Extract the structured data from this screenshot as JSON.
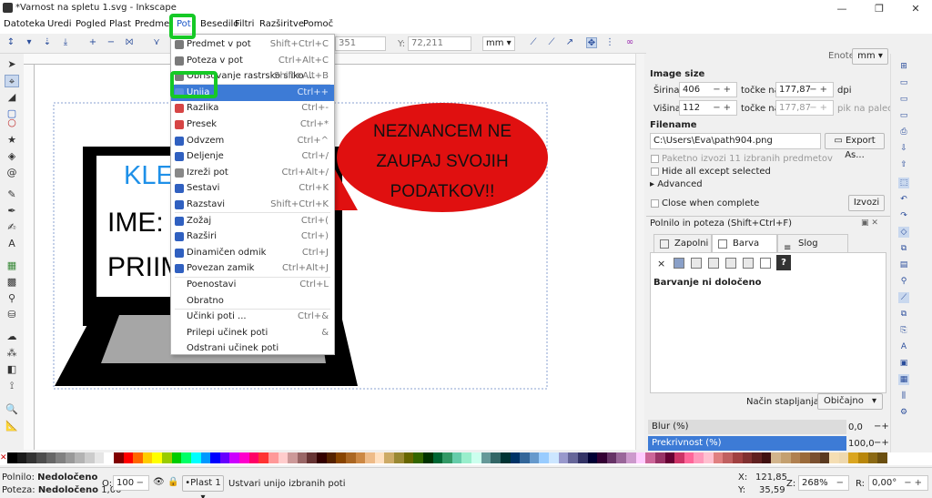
{
  "window": {
    "title": "*Varnost na spletu 1.svg - Inkscape"
  },
  "menubar": {
    "items": [
      "Datoteka",
      "Uredi",
      "Pogled",
      "Plast",
      "Predmet",
      "Pot",
      "Besedilo",
      "Filtri",
      "Razširitve",
      "Pomoč"
    ],
    "active": "Pot"
  },
  "toolctrl": {
    "x_field": "351",
    "y_label": "Y:",
    "y_field": "72,211",
    "unit": "mm"
  },
  "path_menu": {
    "items": [
      {
        "label": "Predmet v pot",
        "shortcut": "Shift+Ctrl+C",
        "icon": "object-to-path-icon",
        "color": "#7a7a7a"
      },
      {
        "label": "Poteza v pot",
        "shortcut": "Ctrl+Alt+C",
        "icon": "stroke-to-path-icon",
        "color": "#7a7a7a"
      },
      {
        "label": "Obrisovanje rastrsko sliko ...",
        "shortcut": "Shift+Alt+B",
        "icon": "trace-bitmap-icon",
        "color": "#7a7a7a"
      },
      {
        "label": "Unija",
        "shortcut": "Ctrl++",
        "icon": "union-icon",
        "color": "#5c8fe0"
      },
      {
        "label": "Razlika",
        "shortcut": "Ctrl+-",
        "icon": "difference-icon",
        "color": "#d64545"
      },
      {
        "label": "Presek",
        "shortcut": "Ctrl+*",
        "icon": "intersection-icon",
        "color": "#d64545"
      },
      {
        "label": "Odvzem",
        "shortcut": "Ctrl+^",
        "icon": "exclusion-icon",
        "color": "#3060c0"
      },
      {
        "label": "Deljenje",
        "shortcut": "Ctrl+/",
        "icon": "division-icon",
        "color": "#3060c0"
      },
      {
        "label": "Izreži pot",
        "shortcut": "Ctrl+Alt+/",
        "icon": "cut-path-icon",
        "color": "#888"
      },
      {
        "label": "Sestavi",
        "shortcut": "Ctrl+K",
        "icon": "combine-icon",
        "color": "#3060c0"
      },
      {
        "label": "Razstavi",
        "shortcut": "Shift+Ctrl+K",
        "icon": "break-apart-icon",
        "color": "#3060c0"
      },
      {
        "label": "Zožaj",
        "shortcut": "Ctrl+(",
        "icon": "inset-icon",
        "color": "#3060c0"
      },
      {
        "label": "Razširi",
        "shortcut": "Ctrl+)",
        "icon": "outset-icon",
        "color": "#3060c0"
      },
      {
        "label": "Dinamičen odmik",
        "shortcut": "Ctrl+J",
        "icon": "dynamic-offset-icon",
        "color": "#3060c0"
      },
      {
        "label": "Povezan zamik",
        "shortcut": "Ctrl+Alt+J",
        "icon": "linked-offset-icon",
        "color": "#3060c0"
      },
      {
        "label": "Poenostavi",
        "shortcut": "Ctrl+L",
        "icon": "",
        "color": ""
      },
      {
        "label": "Obratno",
        "shortcut": "",
        "icon": "",
        "color": ""
      },
      {
        "label": "Učinki poti ...",
        "shortcut": "Ctrl+&",
        "icon": "",
        "color": ""
      },
      {
        "label": "Prilepi učinek poti",
        "shortcut": "&",
        "icon": "",
        "color": ""
      },
      {
        "label": "Odstrani učinek poti",
        "shortcut": "",
        "icon": "",
        "color": ""
      }
    ],
    "selected_index": 3
  },
  "canvas": {
    "monitor_text": [
      "KLE",
      "IME:",
      "PRIIM"
    ],
    "speech_bubble": [
      "NEZNANCEM NE",
      "ZAUPAJ SVOJIH",
      "PODATKOV!!"
    ]
  },
  "export_panel": {
    "units_label": "Enote:",
    "units_value": "mm",
    "image_size_title": "Image size",
    "width_label": "Širina:",
    "width_value": "406",
    "height_label": "Višina:",
    "height_value": "112",
    "dots_at_label": "točke na",
    "dpi_value": "177,87",
    "dpi_unit": "dpi",
    "dpi2_value": "177,87",
    "dpi2_unit": "pik na palec",
    "filename_title": "Filename",
    "filename_value": "C:\\Users\\Eva\\path904.png",
    "export_as_label": "Export As...",
    "batch_label": "Paketno izvozi 11 izbranih predmetov",
    "hide_label": "Hide all except selected",
    "advanced_label": "Advanced",
    "close_label": "Close when complete",
    "export_label": "Izvozi"
  },
  "fill_panel": {
    "title": "Polnilo in poteza  (Shift+Ctrl+F)",
    "tabs": [
      "Zapolni",
      "Barva poteze",
      "Slog poteze"
    ],
    "active_tab": 1,
    "no_paint": "×",
    "message": "Barvanje ni določeno",
    "blend_label": "Način stapljanja:",
    "blend_value": "Običajno",
    "blur_label": "Blur (%)",
    "blur_value": "0,0",
    "opacity_label": "Prekrivnost (%)",
    "opacity_value": "100,0"
  },
  "status": {
    "fill_label": "Polnilo:",
    "fill_value": "Nedoločeno",
    "stroke_label": "Poteza:",
    "stroke_value": "Nedoločeno",
    "stroke_width": "1,00",
    "o_label": "O:",
    "o_value": "100",
    "layer": "•Plast 1",
    "message": "Ustvari unijo izbranih poti",
    "x_label": "X:",
    "x_value": "121,85",
    "y_label": "Y:",
    "y_value": "35,59",
    "zoom_label": "Z:",
    "zoom_value": "268%",
    "rot_label": "R:",
    "rot_value": "0,00°"
  },
  "colors": {
    "accent": "#3d7bd6",
    "highlight_green": "#16c926",
    "bubble_red": "#e01010",
    "monitor_blue_text": "#1e90e8"
  }
}
